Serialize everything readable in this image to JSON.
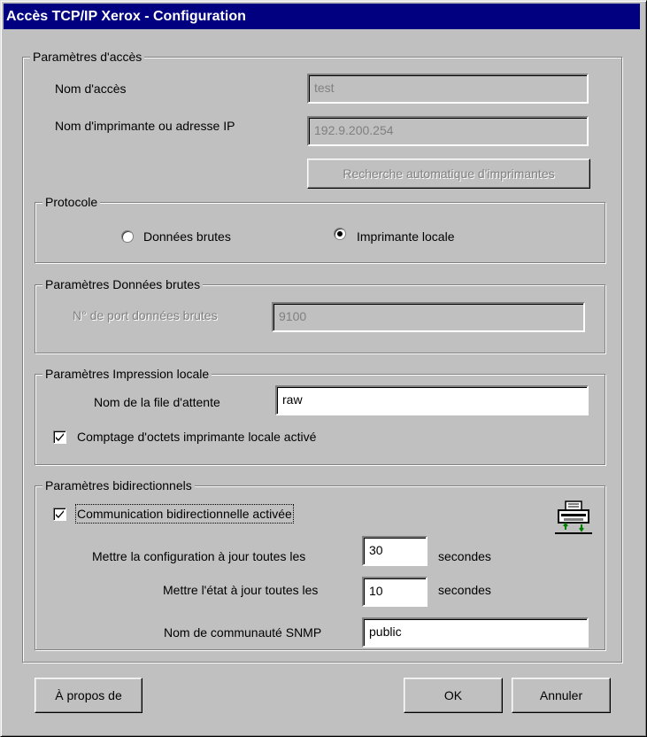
{
  "window": {
    "title": "Accès TCP/IP Xerox - Configuration"
  },
  "access": {
    "legend": "Paramètres d'accès",
    "username_label": "Nom d'accès",
    "username_value": "test",
    "printer_label": "Nom d'imprimante ou adresse IP",
    "printer_value": "192.9.200.254",
    "search_button": "Recherche automatique d'imprimantes"
  },
  "protocol": {
    "legend": "Protocole",
    "raw_label": "Données brutes",
    "raw_selected": false,
    "lpr_label": "Imprimante locale",
    "lpr_selected": true
  },
  "raw_params": {
    "legend": "Paramètres Données brutes",
    "port_label": "N° de port données brutes",
    "port_value": "9100"
  },
  "lpr_params": {
    "legend": "Paramètres Impression locale",
    "queue_label": "Nom de la file d'attente",
    "queue_value": "raw",
    "bytecount_label": "Comptage d'octets imprimante locale activé",
    "bytecount_checked": true
  },
  "bidi": {
    "legend": "Paramètres bidirectionnels",
    "enable_label": "Communication bidirectionnelle activée",
    "enable_checked": true,
    "config_label": "Mettre la configuration à jour toutes les",
    "config_value": "30",
    "config_unit": "secondes",
    "status_label": "Mettre l'état à jour toutes les",
    "status_value": "10",
    "status_unit": "secondes",
    "snmp_label": "Nom de communauté SNMP",
    "snmp_value": "public",
    "icon": "printer-icon"
  },
  "buttons": {
    "about": "À propos de",
    "ok": "OK",
    "cancel": "Annuler"
  }
}
